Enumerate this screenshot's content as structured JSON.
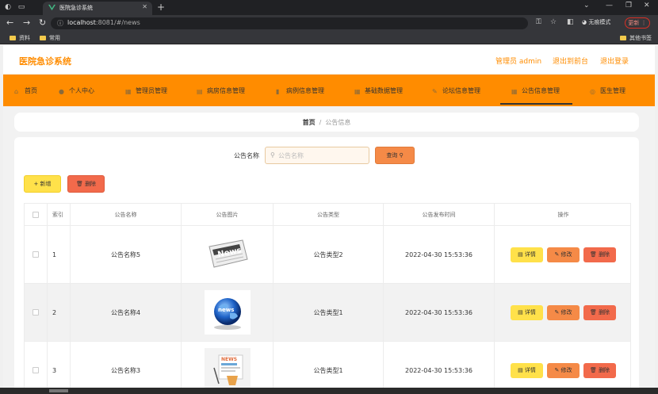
{
  "browser": {
    "tab_title": "医院急诊系统",
    "url_host": "localhost",
    "url_rest": ":8081/#/news",
    "profile_label": "无痕模式",
    "update_label": "更新",
    "bookmarks": [
      "资料",
      "常用"
    ],
    "other_bookmarks": "其他书签"
  },
  "header": {
    "site_title": "医院急诊系统",
    "admin_label": "管理员 admin",
    "back_front": "退出到前台",
    "logout": "退出登录"
  },
  "nav": {
    "items": [
      {
        "label": "首页",
        "icon": "home-icon"
      },
      {
        "label": "个人中心",
        "icon": "user-icon"
      },
      {
        "label": "管理员管理",
        "icon": "grid-icon"
      },
      {
        "label": "病房信息管理",
        "icon": "bed-icon"
      },
      {
        "label": "病例信息管理",
        "icon": "chart-icon"
      },
      {
        "label": "基础数据管理",
        "icon": "grid-icon"
      },
      {
        "label": "论坛信息管理",
        "icon": "pencil-icon"
      },
      {
        "label": "公告信息管理",
        "icon": "grid-icon"
      },
      {
        "label": "医生管理",
        "icon": "circle-icon"
      }
    ],
    "active_index": 7
  },
  "breadcrumb": {
    "home": "首页",
    "sep": "/",
    "current": "公告信息"
  },
  "search": {
    "label": "公告名称",
    "placeholder": "公告名称",
    "value": "",
    "query_label": "查询"
  },
  "actions": {
    "add_label": "+ 新增",
    "delete_label": "删除"
  },
  "table": {
    "headers": [
      "索引",
      "公告名称",
      "公告图片",
      "公告类型",
      "公告发布时间",
      "操作"
    ],
    "rows": [
      {
        "index": "1",
        "name": "公告名称5",
        "image": "news-newspaper",
        "type": "公告类型2",
        "time": "2022-04-30 15:53:36"
      },
      {
        "index": "2",
        "name": "公告名称4",
        "image": "news-globe",
        "type": "公告类型1",
        "time": "2022-04-30 15:53:36"
      },
      {
        "index": "3",
        "name": "公告名称3",
        "image": "news-paper-cup",
        "type": "公告类型1",
        "time": "2022-04-30 15:53:36"
      }
    ],
    "op_labels": {
      "detail": "详情",
      "edit": "修改",
      "remove": "删除"
    }
  },
  "colors": {
    "primary": "#ff8c00",
    "yellow": "#ffe14a",
    "orange": "#f58a47",
    "red": "#f26a4b"
  }
}
